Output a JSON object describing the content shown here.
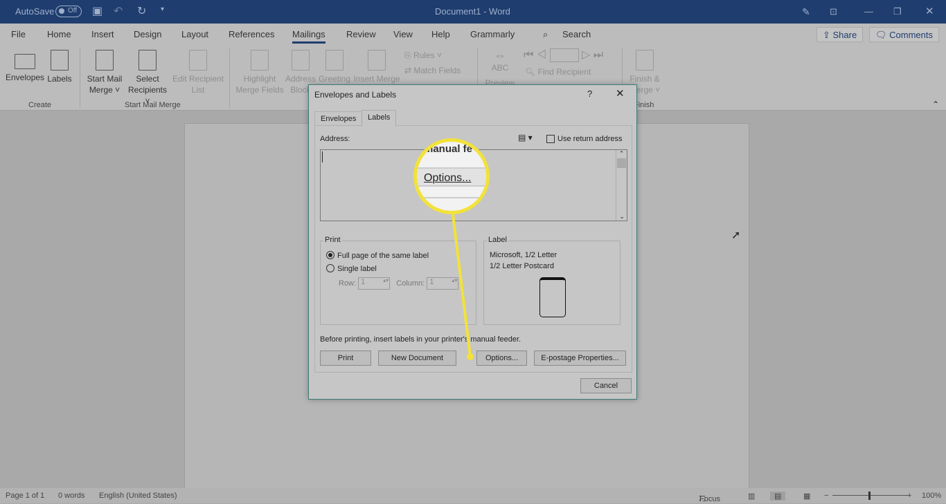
{
  "titlebar": {
    "autosave": "AutoSave",
    "autosave_state": "Off",
    "document_title": "Document1 - Word"
  },
  "menu_tabs": [
    "File",
    "Home",
    "Insert",
    "Design",
    "Layout",
    "References",
    "Mailings",
    "Review",
    "View",
    "Help",
    "Grammarly"
  ],
  "active_tab": "Mailings",
  "search": "Search",
  "share": "Share",
  "comments": "Comments",
  "ribbon": {
    "envelopes": "Envelopes",
    "labels": "Labels",
    "group_create": "Create",
    "start_mail_merge": "Start Mail Merge",
    "select_recipients": "Select Recipients",
    "edit_recipient_list": "Edit Recipient List",
    "group_start": "Start Mail Merge",
    "highlight": "Highlight Merge Fields",
    "address_block": "Address Block",
    "greeting": "Greeting",
    "insert_merge": "Insert Merge",
    "rules": "Rules",
    "match_fields": "Match Fields",
    "preview": "Preview",
    "abc": "ABC",
    "find_recipient": "Find Recipient",
    "finish": "Finish & Merge",
    "group_finish": "Finish"
  },
  "dialog": {
    "title": "Envelopes and Labels",
    "help": "?",
    "tabs": [
      "Envelopes",
      "Labels"
    ],
    "active_tab": "Labels",
    "address_label": "Address:",
    "use_return_address": "Use return address",
    "use_return_checked": false,
    "address_value": "",
    "print_group": "Print",
    "full_page": "Full page of the same label",
    "single_label": "Single label",
    "selected_print": "Full page of the same label",
    "row_label": "Row:",
    "row_value": "1",
    "column_label": "Column:",
    "column_value": "1",
    "label_group": "Label",
    "label_line1": "Microsoft, 1/2 Letter",
    "label_line2": "1/2 Letter Postcard",
    "note": "Before printing, insert labels in your printer's manual feeder.",
    "buttons": {
      "print": "Print",
      "new_document": "New Document",
      "options": "Options...",
      "epostage": "E-postage Properties...",
      "cancel": "Cancel"
    }
  },
  "callout": {
    "top_text": "manual fe",
    "button_text": "Options...",
    "color": "#f2e23a"
  },
  "status": {
    "page": "Page 1 of 1",
    "words": "0 words",
    "language": "English (United States)",
    "focus": "Focus",
    "zoom": "100%",
    "zoom_percent": 100
  }
}
